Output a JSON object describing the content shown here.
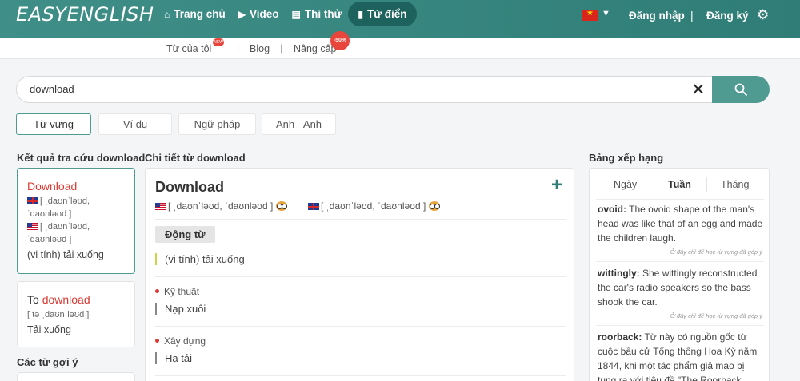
{
  "app": {
    "logo": "EASYENGLISH"
  },
  "nav": {
    "items": [
      {
        "label": "Trang chủ",
        "icon": "home-icon"
      },
      {
        "label": "Video",
        "icon": "play-icon"
      },
      {
        "label": "Thi thử",
        "icon": "document-icon"
      },
      {
        "label": "Từ điển",
        "icon": "book-icon",
        "active": true
      }
    ],
    "login": "Đăng nhập",
    "register": "Đăng ký",
    "separator": "|"
  },
  "subnav": {
    "items": [
      "Từ của tôi",
      "Blog",
      "Nâng cấp"
    ],
    "separator": "|",
    "sale_badge": "-50%",
    "new_badge": "NEW"
  },
  "search": {
    "value": "download"
  },
  "tabs": [
    "Từ vựng",
    "Ví dụ",
    "Ngữ pháp",
    "Anh - Anh"
  ],
  "left": {
    "title": "Kết quả tra cứu download",
    "results": [
      {
        "word": "Download",
        "pron1": "[ ˌdaʊnˈləʊd, ˈdaʊnləʊd ]",
        "pron2": "[ ˌdaʊnˈləʊd, ˈdaʊnləʊd ]",
        "meaning": "(vi tính) tải xuống"
      },
      {
        "prefix": "To ",
        "word": "download",
        "pron": "[ tə ˌdaʊnˈləʊd ]",
        "meaning": "Tải xuống"
      }
    ],
    "suggest_title": "Các từ gợi ý"
  },
  "middle": {
    "title": "Chi tiết từ download",
    "word": "Download",
    "add_label": "+",
    "pron_us": "[ ˌdaʊnˈləʊd, ˈdaʊnləʊd ]",
    "pron_uk": "[ ˌdaʊnˈləʊd, ˈdaʊnləʊd ]",
    "pos": "Động từ",
    "main_meaning": "(vi tính) tải xuống",
    "fields": [
      {
        "field": "Kỹ thuật",
        "meaning": "Nạp xuôi"
      },
      {
        "field": "Xây dựng",
        "meaning": "Hạ tải"
      }
    ]
  },
  "right": {
    "title": "Bảng xếp hạng",
    "tabs": [
      "Ngày",
      "Tuần",
      "Tháng"
    ],
    "entries": [
      {
        "word": "ovoid:",
        "text": " The ovoid shape of the man's head was like that of an egg and made the children laugh."
      },
      {
        "word": "wittingly:",
        "text": " She wittingly reconstructed the car's radio speakers so the bass shook the car."
      },
      {
        "word": "roorback:",
        "text": " Từ này có nguồn gốc từ cuộc bầu cử Tổng thống Hoa Kỳ năm 1844, khi một tác phẩm giả mạo bị tung ra với tiêu đề \"The Roorback"
      }
    ],
    "note": "Ở đây chỉ để học từ vựng đã góp ý"
  },
  "colors": {
    "primary": "#2f7d76",
    "accent": "#d93a32",
    "button": "#4f9b92"
  }
}
